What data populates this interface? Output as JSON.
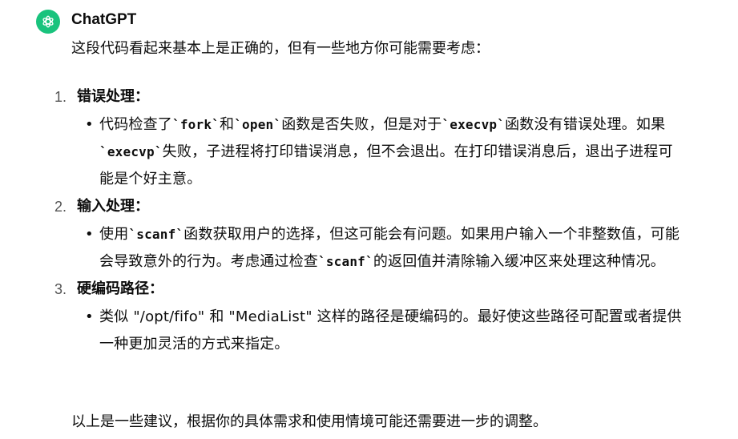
{
  "author": "ChatGPT",
  "intro": "这段代码看起来基本上是正确的，但有一些地方你可能需要考虑：",
  "points": [
    {
      "number": "1.",
      "title": "错误处理：",
      "subs": [
        [
          "代码检查了",
          "`fork`",
          "和",
          "`open`",
          "函数是否失败，但是对于",
          "`execvp`",
          "函数没有错误处理。如果",
          "`execvp`",
          "失败，子进程将打印错误消息，但不会退出。在打印错误消息后，退出子进程可能是个好主意。"
        ]
      ]
    },
    {
      "number": "2.",
      "title": "输入处理：",
      "subs": [
        [
          "使用",
          "`scanf`",
          "函数获取用户的选择，但这可能会有问题。如果用户输入一个非整数值，可能会导致意外的行为。考虑通过检查",
          "`scanf`",
          "的返回值并清除输入缓冲区来处理这种情况。"
        ]
      ]
    },
    {
      "number": "3.",
      "title": "硬编码路径：",
      "subs": [
        [
          "类似 \"/opt/fifo\" 和 \"MediaList\" 这样的路径是硬编码的。最好使这些路径可配置或者提供一种更加灵活的方式来指定。"
        ]
      ]
    }
  ],
  "outro": "以上是一些建议，根据你的具体需求和使用情境可能还需要进一步的调整。",
  "colors": {
    "avatar_bg": "#19c37d",
    "text": "#0d0d0d",
    "list_number": "#555555"
  },
  "icons": {
    "avatar": "openai-logo-icon"
  }
}
